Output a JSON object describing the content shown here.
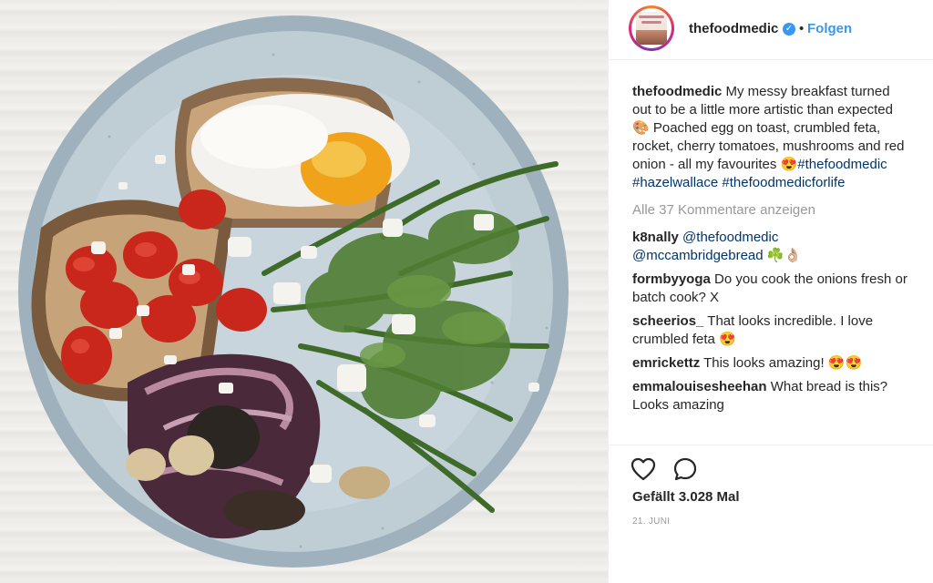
{
  "post": {
    "username": "thefoodmedic",
    "verified_icon": "verified-badge-icon",
    "separator": "•",
    "follow_label": "Folgen",
    "caption": {
      "username": "thefoodmedic",
      "text": " My messy breakfast turned out to be a little more artistic than expected 🎨 Poached egg on toast, crumbled feta, rocket, cherry tomatoes, mushrooms and red onion - all my favourites 😍",
      "hashtags": [
        "#thefoodmedic",
        "#hazelwallace",
        "#thefoodmedicforlife"
      ]
    },
    "view_all_comments": "Alle 37 Kommentare anzeigen",
    "comments": [
      {
        "username": "k8nally",
        "mentions": [
          "@thefoodmedic",
          "@mccambridgebread"
        ],
        "text": " ☘️👌🏼"
      },
      {
        "username": "formbyyoga",
        "text": " Do you cook the onions fresh or batch cook? X"
      },
      {
        "username": "scheerios_",
        "text": " That looks incredible. I love crumbled feta 😍"
      },
      {
        "username": "emrickettz",
        "text": " This looks amazing! 😍😍"
      },
      {
        "username": "emmalouisesheehan",
        "text": " What bread is this? Looks amazing"
      }
    ],
    "likes": "Gefällt 3.028 Mal",
    "date": "21. JUNI",
    "icons": {
      "like": "heart-icon",
      "comment": "comment-bubble-icon"
    },
    "colors": {
      "link": "#003569",
      "follow": "#3897f0",
      "muted": "#999999"
    }
  }
}
